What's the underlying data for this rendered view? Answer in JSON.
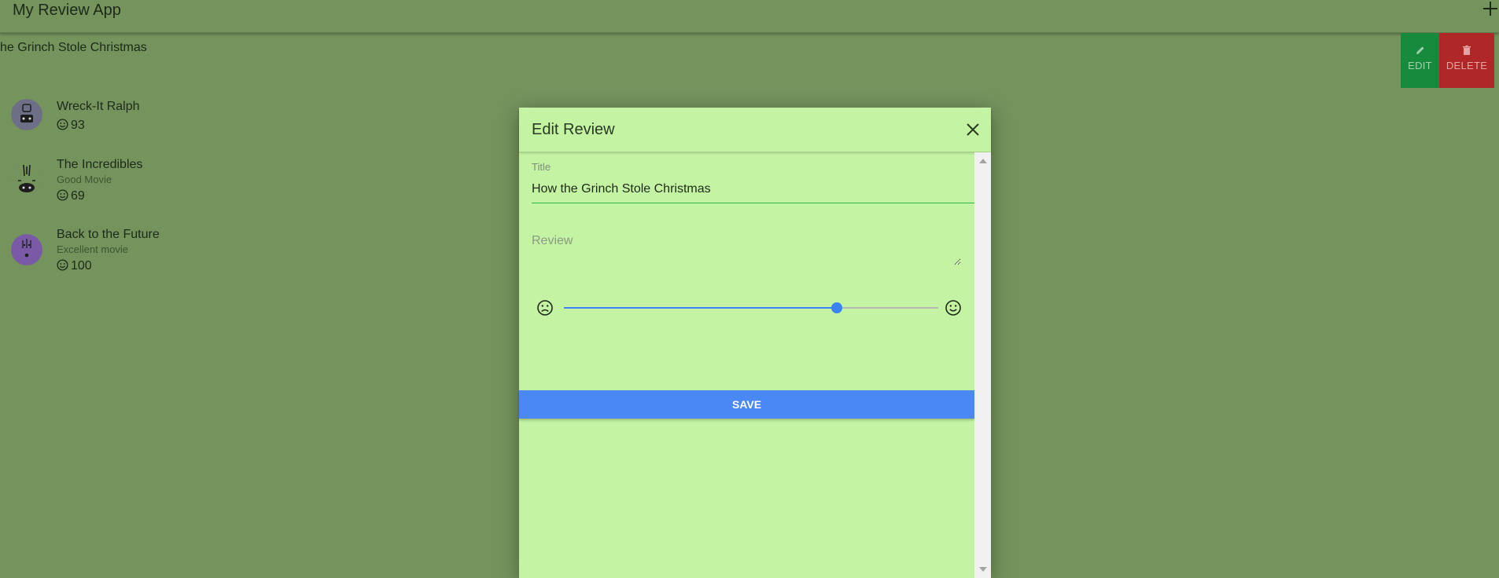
{
  "app": {
    "title": "My Review App",
    "add_icon": "plus-icon"
  },
  "swiped_item": {
    "title": "he Grinch Stole Christmas",
    "edit_label": "EDIT",
    "delete_label": "DELETE",
    "edit_color": "#188a3e",
    "delete_color": "#b02727"
  },
  "reviews": [
    {
      "title": "Wreck-It Ralph",
      "subtitle": "",
      "score": "93",
      "avatar": "robot-avatar"
    },
    {
      "title": "The Incredibles",
      "subtitle": "Good Movie",
      "score": "69",
      "avatar": "monster-avatar"
    },
    {
      "title": "Back to the Future",
      "subtitle": "Excellent movie",
      "score": "100",
      "avatar": "purple-face-avatar"
    }
  ],
  "dialog": {
    "title": "Edit Review",
    "title_label": "Title",
    "title_value": "How the Grinch Stole Christmas",
    "review_placeholder": "Review",
    "review_value": "",
    "rating_fraction": 0.73,
    "save_label": "SAVE",
    "accent_color": "#4a89f5",
    "background_color": "#c4f3a4"
  },
  "page": {
    "background_color": "#74935d"
  }
}
